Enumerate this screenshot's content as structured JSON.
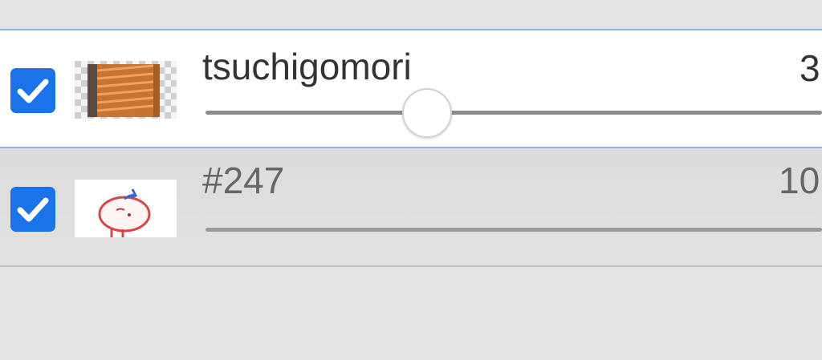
{
  "layers": [
    {
      "name": "tsuchigomori",
      "opacity": "3",
      "opacity_fraction": 0.36,
      "visible": true,
      "thumbnail_icon": "striped-texture-icon",
      "selected": true
    },
    {
      "name": "#247",
      "opacity": "10",
      "opacity_fraction": 1.0,
      "visible": true,
      "thumbnail_icon": "character-sketch-icon",
      "selected": false
    }
  ],
  "colors": {
    "checkbox": "#1a73e8",
    "selection_border": "#8fb0e6",
    "background": "#e3e3e3"
  }
}
